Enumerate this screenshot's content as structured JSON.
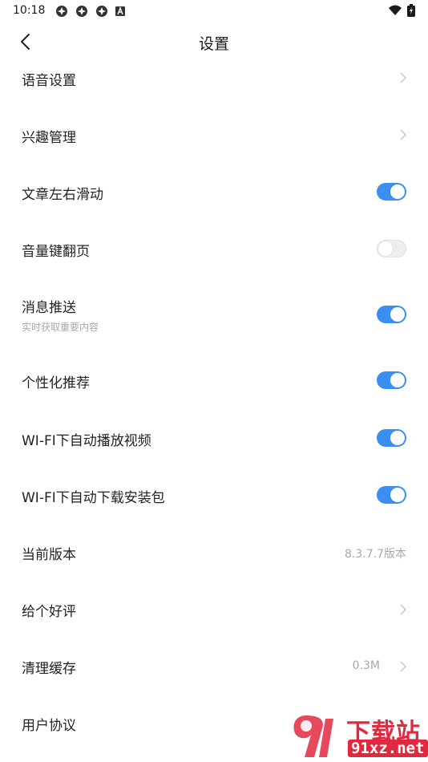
{
  "status_bar": {
    "time": "10:18"
  },
  "header": {
    "title": "设置"
  },
  "rows": [
    {
      "label": "语音设置",
      "type": "chevron"
    },
    {
      "label": "兴趣管理",
      "type": "chevron"
    },
    {
      "label": "文章左右滑动",
      "type": "toggle",
      "on": true
    },
    {
      "label": "音量键翻页",
      "type": "toggle",
      "on": false
    },
    {
      "label": "消息推送",
      "sub": "实时获取重要内容",
      "type": "toggle",
      "on": true
    },
    {
      "label": "个性化推荐",
      "type": "toggle",
      "on": true
    },
    {
      "label": "WI-FI下自动播放视频",
      "type": "toggle",
      "on": true
    },
    {
      "label": "WI-FI下自动下载安装包",
      "type": "toggle",
      "on": true
    },
    {
      "label": "当前版本",
      "type": "value",
      "value": "8.3.7.7版本"
    },
    {
      "label": "给个好评",
      "type": "chevron"
    },
    {
      "label": "清理缓存",
      "type": "value-chevron",
      "value": "0.3M"
    },
    {
      "label": "用户协议",
      "type": "none"
    }
  ],
  "watermark": {
    "text": "下载站",
    "url": "91xz.net"
  },
  "colors": {
    "toggle_on": "#3b8ff1",
    "toggle_off": "#eeeeee",
    "watermark": "#e0293e"
  }
}
